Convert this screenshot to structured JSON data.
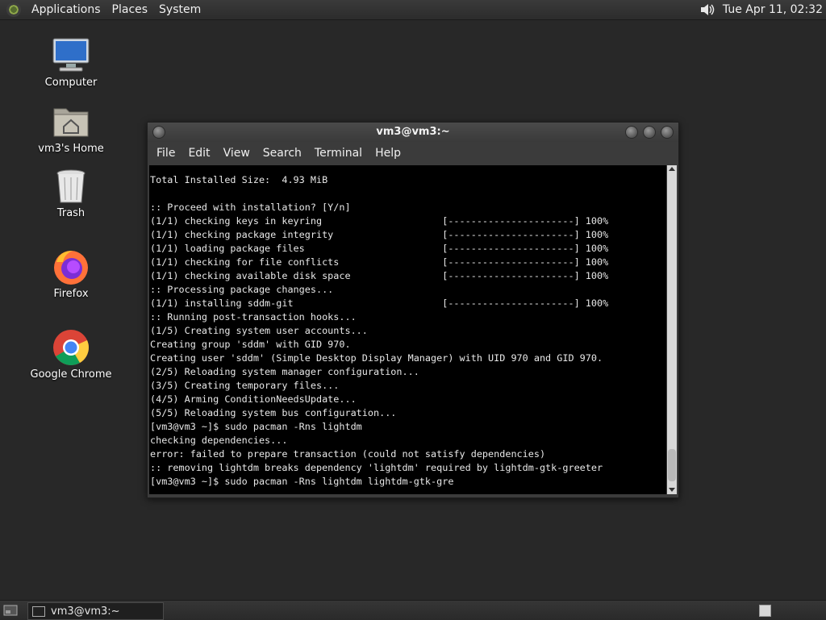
{
  "top_panel": {
    "menus": [
      "Applications",
      "Places",
      "System"
    ],
    "clock": "Tue Apr 11, 02:32"
  },
  "desktop": {
    "icons": [
      {
        "label": "Computer",
        "icon": "computer-icon"
      },
      {
        "label": "vm3's Home",
        "icon": "home-folder-icon"
      },
      {
        "label": "Trash",
        "icon": "trash-icon"
      },
      {
        "label": "Firefox",
        "icon": "firefox-icon"
      },
      {
        "label": "Google Chrome",
        "icon": "chrome-icon"
      }
    ]
  },
  "window": {
    "title": "vm3@vm3:~",
    "menus": [
      "File",
      "Edit",
      "View",
      "Search",
      "Terminal",
      "Help"
    ],
    "terminal_lines": [
      "Total Installed Size:  4.93 MiB",
      "",
      ":: Proceed with installation? [Y/n]",
      "(1/1) checking keys in keyring                     [----------------------] 100%",
      "(1/1) checking package integrity                   [----------------------] 100%",
      "(1/1) loading package files                        [----------------------] 100%",
      "(1/1) checking for file conflicts                  [----------------------] 100%",
      "(1/1) checking available disk space                [----------------------] 100%",
      ":: Processing package changes...",
      "(1/1) installing sddm-git                          [----------------------] 100%",
      ":: Running post-transaction hooks...",
      "(1/5) Creating system user accounts...",
      "Creating group 'sddm' with GID 970.",
      "Creating user 'sddm' (Simple Desktop Display Manager) with UID 970 and GID 970.",
      "(2/5) Reloading system manager configuration...",
      "(3/5) Creating temporary files...",
      "(4/5) Arming ConditionNeedsUpdate...",
      "(5/5) Reloading system bus configuration...",
      "[vm3@vm3 ~]$ sudo pacman -Rns lightdm",
      "checking dependencies...",
      "error: failed to prepare transaction (could not satisfy dependencies)",
      ":: removing lightdm breaks dependency 'lightdm' required by lightdm-gtk-greeter",
      "[vm3@vm3 ~]$ sudo pacman -Rns lightdm lightdm-gtk-gre"
    ]
  },
  "taskbar": {
    "task_label": "vm3@vm3:~"
  }
}
